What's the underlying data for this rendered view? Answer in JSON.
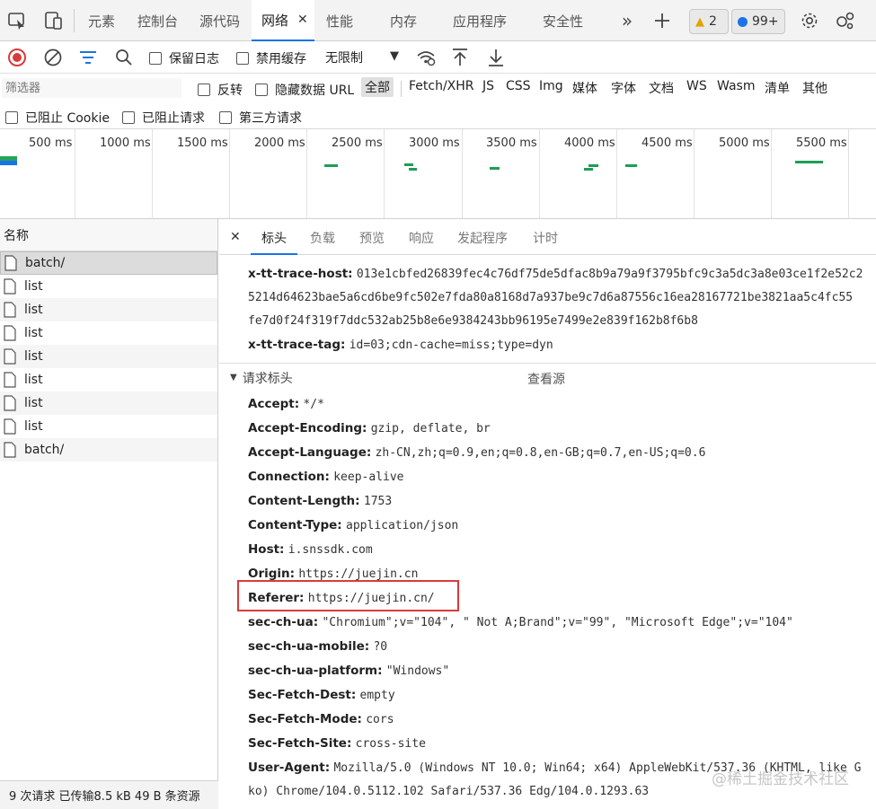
{
  "tabbar": {
    "tabs": [
      {
        "label": "元素"
      },
      {
        "label": "控制台"
      },
      {
        "label": "源代码"
      },
      {
        "label": "网络"
      },
      {
        "label": "性能"
      },
      {
        "label": "内存"
      },
      {
        "label": "应用程序"
      },
      {
        "label": "安全性"
      }
    ],
    "active_tab": "网络",
    "warning_count": "2",
    "message_count": "99+"
  },
  "toolbar": {
    "preserve_log": "保留日志",
    "disable_cache": "禁用缓存",
    "throttle": "无限制"
  },
  "filter": {
    "placeholder": "筛选器",
    "invert": "反转",
    "hide_data_urls": "隐藏数据 URL",
    "types": [
      "全部",
      "Fetch/XHR",
      "JS",
      "CSS",
      "Img",
      "媒体",
      "字体",
      "文档",
      "WS",
      "Wasm",
      "清单",
      "其他"
    ],
    "blocked_cookies": "已阻止 Cookie",
    "blocked_requests": "已阻止请求",
    "third_party": "第三方请求"
  },
  "timeline": {
    "ticks": [
      "500 ms",
      "1000 ms",
      "1500 ms",
      "2000 ms",
      "2500 ms",
      "3000 ms",
      "3500 ms",
      "4000 ms",
      "4500 ms",
      "5000 ms",
      "5500 ms"
    ]
  },
  "requests": {
    "header": "名称",
    "items": [
      "batch/",
      "list",
      "list",
      "list",
      "list",
      "list",
      "list",
      "list",
      "batch/"
    ],
    "status": "9 次请求  已传输8.5 kB  49 B 条资源"
  },
  "detail": {
    "tabs": [
      "标头",
      "负载",
      "预览",
      "响应",
      "发起程序",
      "计时"
    ],
    "response_headers": {
      "trace_host_name": "x-tt-trace-host:",
      "trace_host_lines": [
        "013e1cbfed26839fec4c76df75de5dfac8b9a79a9f3795bfc9c3a5dc3a8e03ce1f2e52c2",
        "5214d64623bae5a6cd6be9fc502e7fda80a8168d7a937be9c7d6a87556c16ea28167721be3821aa5c4fc55",
        "fe7d0f24f319f7ddc532ab25b8e6e9384243bb96195e7499e2e839f162b8f6b8"
      ],
      "trace_tag_name": "x-tt-trace-tag:",
      "trace_tag_value": "id=03;cdn-cache=miss;type=dyn"
    },
    "request_section_title": "请求标头",
    "view_source": "查看源",
    "request_headers": [
      {
        "name": "Accept:",
        "value": "*/*"
      },
      {
        "name": "Accept-Encoding:",
        "value": "gzip, deflate, br"
      },
      {
        "name": "Accept-Language:",
        "value": "zh-CN,zh;q=0.9,en;q=0.8,en-GB;q=0.7,en-US;q=0.6"
      },
      {
        "name": "Connection:",
        "value": "keep-alive"
      },
      {
        "name": "Content-Length:",
        "value": "1753"
      },
      {
        "name": "Content-Type:",
        "value": "application/json"
      },
      {
        "name": "Host:",
        "value": "i.snssdk.com"
      },
      {
        "name": "Origin:",
        "value": "https://juejin.cn"
      },
      {
        "name": "Referer:",
        "value": "https://juejin.cn/"
      },
      {
        "name": "sec-ch-ua:",
        "value": "\"Chromium\";v=\"104\", \" Not A;Brand\";v=\"99\", \"Microsoft Edge\";v=\"104\""
      },
      {
        "name": "sec-ch-ua-mobile:",
        "value": "?0"
      },
      {
        "name": "sec-ch-ua-platform:",
        "value": "\"Windows\""
      },
      {
        "name": "Sec-Fetch-Dest:",
        "value": "empty"
      },
      {
        "name": "Sec-Fetch-Mode:",
        "value": "cors"
      },
      {
        "name": "Sec-Fetch-Site:",
        "value": "cross-site"
      },
      {
        "name": "User-Agent:",
        "value": "Mozilla/5.0 (Windows NT 10.0; Win64; x64) AppleWebKit/537.36 (KHTML, like G"
      }
    ],
    "user_agent_cont": "ko) Chrome/104.0.5112.102 Safari/537.36 Edg/104.0.1293.63"
  },
  "watermark": "@稀土掘金技术社区",
  "colors": {
    "accent": "#1a73e8",
    "record": "#d83b3b",
    "timeline_bar": "#1f9d55",
    "highlight_box": "#d83b3b"
  }
}
